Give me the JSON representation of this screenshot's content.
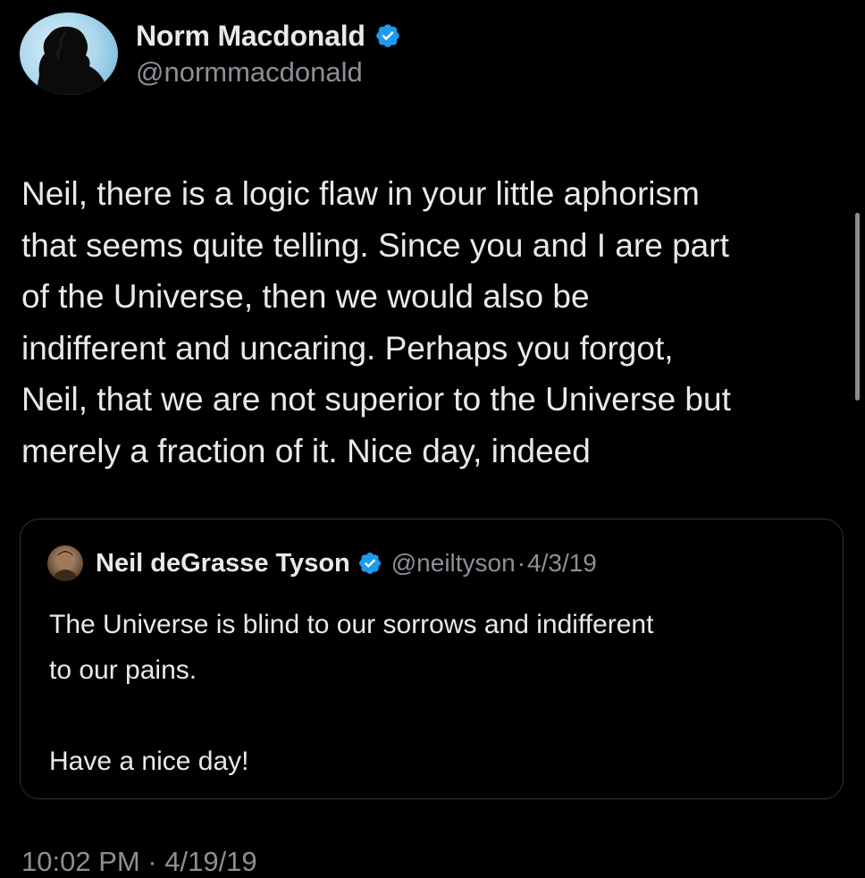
{
  "tweet": {
    "author": {
      "display_name": "Norm Macdonald",
      "handle": "@normmacdonald",
      "verified_icon": "verified-badge-icon"
    },
    "text": "Neil, there is a logic flaw in your little aphorism\nthat seems quite telling. Since you and I are part\nof the Universe, then we would also be\nindifferent and uncaring. Perhaps you forgot,\nNeil, that we are not superior to the Universe but\nmerely a fraction of it. Nice day, indeed",
    "timestamp": "10:02 PM · 4/19/19"
  },
  "quoted_tweet": {
    "author": {
      "display_name": "Neil deGrasse Tyson",
      "handle": "@neiltyson",
      "separator": "·",
      "date": "4/3/19",
      "verified_icon": "verified-badge-icon"
    },
    "text": "The Universe is blind to our sorrows and indifferent\nto our pains.\n\nHave  a nice day!"
  },
  "colors": {
    "background": "#000000",
    "text_primary": "#e7e9ea",
    "text_secondary": "#8b9096",
    "verified_blue": "#1d9bf0",
    "border": "#2f3336"
  }
}
